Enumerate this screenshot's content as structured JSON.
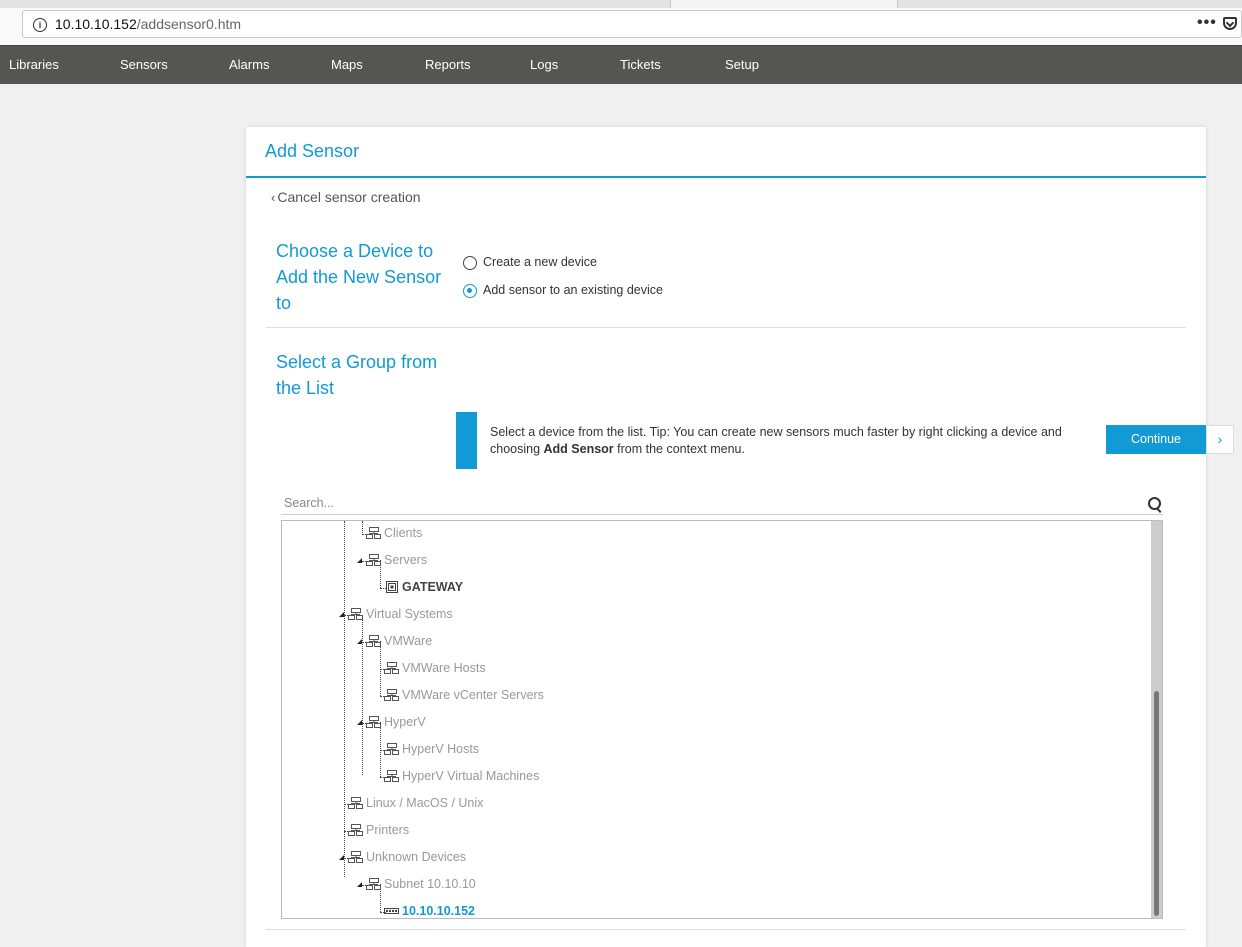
{
  "browser": {
    "url_host": "10.10.10.152",
    "url_path": "/addsensor0.htm"
  },
  "menu": [
    "Libraries",
    "Sensors",
    "Alarms",
    "Maps",
    "Reports",
    "Logs",
    "Tickets",
    "Setup"
  ],
  "panel": {
    "title": "Add Sensor",
    "cancel_label": "Cancel sensor creation",
    "choose_title": "Choose a Device to Add the New Sensor to",
    "radio_new": "Create a new device",
    "radio_existing": "Add sensor to an existing device",
    "radio_selected": "existing",
    "group_title": "Select a Group from the List",
    "tip_text_pre": "Select a device from the list. Tip: You can create new sensors much faster by right clicking a device and choosing ",
    "tip_text_bold": "Add Sensor",
    "tip_text_post": " from the context menu.",
    "continue_label": "Continue",
    "continue_arrow": "›",
    "search_placeholder": "Search..."
  },
  "tree": [
    {
      "label": "Clients",
      "level": 1,
      "type": "group",
      "expandable": false
    },
    {
      "label": "Servers",
      "level": 1,
      "type": "group",
      "expandable": true
    },
    {
      "label": "GATEWAY",
      "level": 2,
      "type": "device",
      "expandable": false,
      "style": "bold"
    },
    {
      "label": "Virtual Systems",
      "level": 0,
      "type": "group",
      "expandable": true
    },
    {
      "label": "VMWare",
      "level": 1,
      "type": "group",
      "expandable": true
    },
    {
      "label": "VMWare Hosts",
      "level": 2,
      "type": "group",
      "expandable": false
    },
    {
      "label": "VMWare vCenter Servers",
      "level": 2,
      "type": "group",
      "expandable": false
    },
    {
      "label": "HyperV",
      "level": 1,
      "type": "group",
      "expandable": true
    },
    {
      "label": "HyperV Hosts",
      "level": 2,
      "type": "group",
      "expandable": false
    },
    {
      "label": "HyperV Virtual Machines",
      "level": 2,
      "type": "group",
      "expandable": false
    },
    {
      "label": "Linux / MacOS / Unix",
      "level": 0,
      "type": "group",
      "expandable": false
    },
    {
      "label": "Printers",
      "level": 0,
      "type": "group",
      "expandable": false
    },
    {
      "label": "Unknown Devices",
      "level": 0,
      "type": "group",
      "expandable": true
    },
    {
      "label": "Subnet 10.10.10",
      "level": 1,
      "type": "group",
      "expandable": true
    },
    {
      "label": "10.10.10.152",
      "level": 2,
      "type": "ip-device",
      "expandable": false,
      "style": "link"
    }
  ],
  "colors": {
    "accent": "#119ad6",
    "menubar": "#555553",
    "muted_text": "#999999"
  }
}
